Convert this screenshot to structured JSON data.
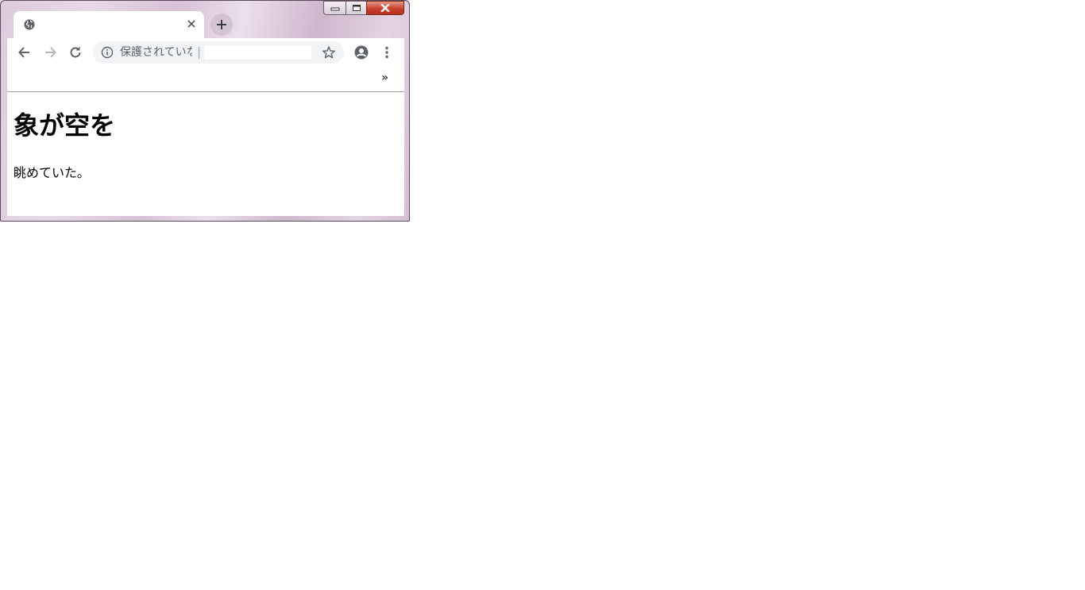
{
  "window": {
    "caption_buttons": [
      "minimize",
      "maximize",
      "close"
    ]
  },
  "tab": {
    "title": "",
    "favicon": "globe-icon",
    "close_icon": "close-icon"
  },
  "toolbar": {
    "back_icon": "back-arrow-icon",
    "forward_icon": "forward-arrow-icon",
    "reload_icon": "reload-icon",
    "omnibox": {
      "security_icon": "info-icon",
      "security_text": "保護されていな",
      "url": "",
      "bookmark_icon": "star-icon"
    },
    "profile_icon": "account-circle-icon",
    "menu_icon": "more-vert-icon"
  },
  "bookmarks_bar": {
    "overflow_label": "»"
  },
  "page": {
    "heading": "象が空を",
    "paragraph": "眺めていた。"
  },
  "colors": {
    "frame": "#dccbdc",
    "close_button": "#c8412c",
    "omnibox_bg": "#f1f3f4",
    "icon": "#5f6368"
  }
}
